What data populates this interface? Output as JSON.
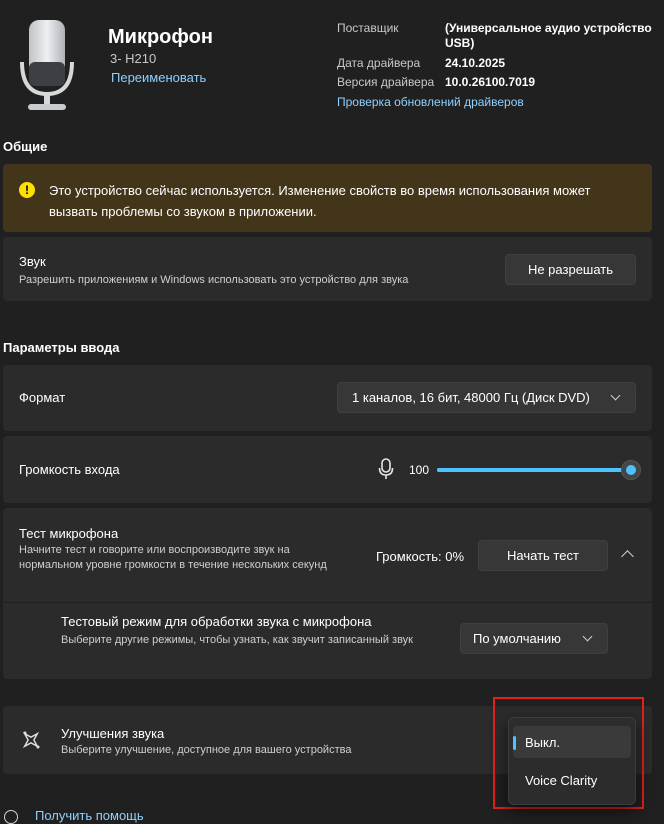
{
  "device": {
    "name": "Микрофон",
    "subtitle": "3- H210",
    "rename_label": "Переименовать"
  },
  "driver": {
    "provider_label": "Поставщик",
    "provider_value": "(Универсальное аудио устройство USB)",
    "date_label": "Дата драйвера",
    "date_value": "24.10.2025",
    "version_label": "Версия драйвера",
    "version_value": "10.0.26100.7019",
    "update_link": "Проверка обновлений драйверов"
  },
  "general": {
    "heading": "Общие",
    "warning_text": "Это устройство сейчас используется. Изменение свойств во время использования может вызвать проблемы со звуком в приложении.",
    "audio_title": "Звук",
    "audio_desc": "Разрешить приложениям и Windows использовать это устройство для звука",
    "audio_button": "Не разрешать"
  },
  "input": {
    "heading": "Параметры ввода",
    "format_label": "Формат",
    "format_value": "1 каналов, 16 бит, 48000 Гц (Диск DVD)",
    "volume_label": "Громкость входа",
    "volume_value": "100",
    "volume_level": 1.0,
    "test_title": "Тест микрофона",
    "test_desc": "Начните тест и говорите или воспроизводите звук на нормальном уровне громкости в течение нескольких секунд",
    "test_volume": "Громкость: 0%",
    "test_button": "Начать тест",
    "test_mode_title": "Тестовый режим для обработки звука с микрофона",
    "test_mode_desc": "Выберите другие режимы, чтобы узнать, как звучит записанный звук",
    "test_mode_value": "По умолчанию",
    "enh_title": "Улучшения звука",
    "enh_desc": "Выберите улучшение, доступное для вашего устройства"
  },
  "enh_dropdown": {
    "options": [
      "Выкл.",
      "Voice Clarity"
    ],
    "selected": "Выкл."
  },
  "footer": {
    "help_link": "Получить помощь"
  },
  "colors": {
    "accent": "#4cc2ff",
    "highlight_box": "#e0201b",
    "warning_bg": "#433519"
  }
}
